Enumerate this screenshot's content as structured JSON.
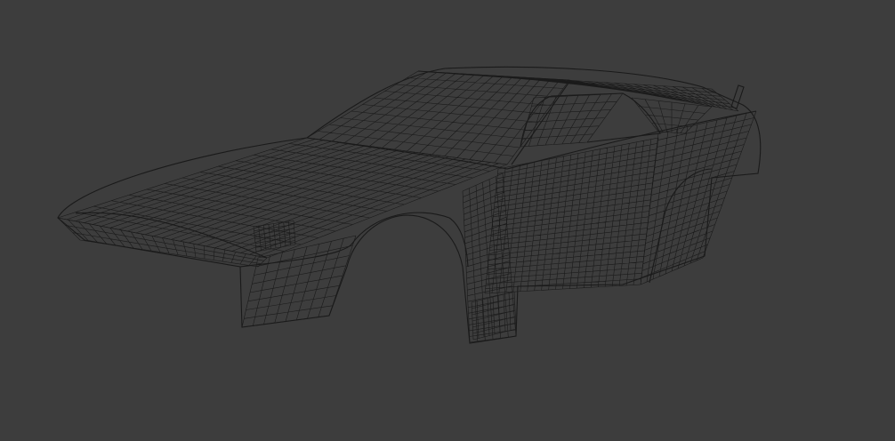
{
  "viewport": {
    "background_color": "#3d3d3d",
    "wire_color": "#1a1a1a",
    "object": "car-body-wireframe-mesh"
  }
}
